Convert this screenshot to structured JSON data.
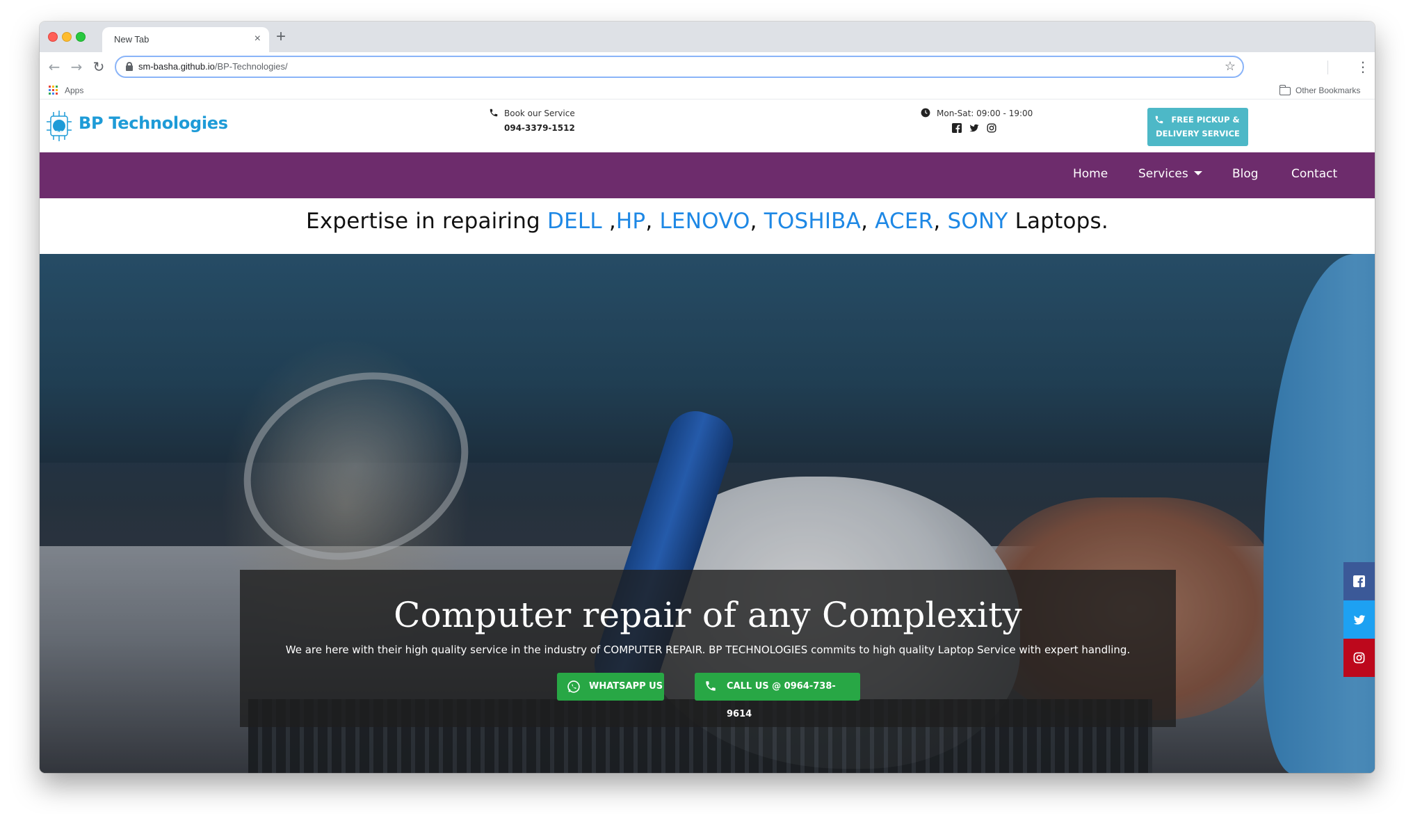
{
  "browser": {
    "tab_title": "New Tab",
    "tab_close": "×",
    "new_tab": "+",
    "url_host": "sm-basha.github.io",
    "url_path": "/BP-Technologies/",
    "apps_label": "Apps",
    "other_bookmarks": "Other Bookmarks"
  },
  "header": {
    "brand": "BP Technologies",
    "logo_text": "BP",
    "book_label": "Book our Service",
    "book_phone": "094-3379-1512",
    "hours": "Mon-Sat: 09:00 - 19:00",
    "pickup_line1": "FREE PICKUP &",
    "pickup_line2": "DELIVERY SERVICE"
  },
  "nav": {
    "items": [
      "Home",
      "Services",
      "Blog",
      "Contact"
    ]
  },
  "tagline": {
    "prefix": "Expertise in repairing ",
    "brands": [
      "DELL",
      "HP",
      "LENOVO",
      "TOSHIBA",
      "ACER",
      "SONY"
    ],
    "suffix": " Laptops."
  },
  "hero": {
    "title": "Computer repair of any Complexity",
    "subtitle": "We are here with their high quality service in the industry of COMPUTER REPAIR. BP TECHNOLOGIES commits to high quality Laptop Service with expert handling.",
    "whatsapp_label": "WHATSAPP US",
    "call_label": "CALL US @ 0964-738-9614"
  },
  "colors": {
    "brand_blue": "#1e9bd7",
    "nav_purple": "#6d2c6c",
    "cta_green": "#28a745",
    "pickup_teal": "#4db8c7"
  },
  "icons": [
    "phone-icon",
    "clock-icon",
    "facebook-icon",
    "twitter-icon",
    "instagram-icon",
    "whatsapp-icon",
    "lock-icon",
    "star-icon",
    "folder-icon",
    "apps-icon"
  ]
}
